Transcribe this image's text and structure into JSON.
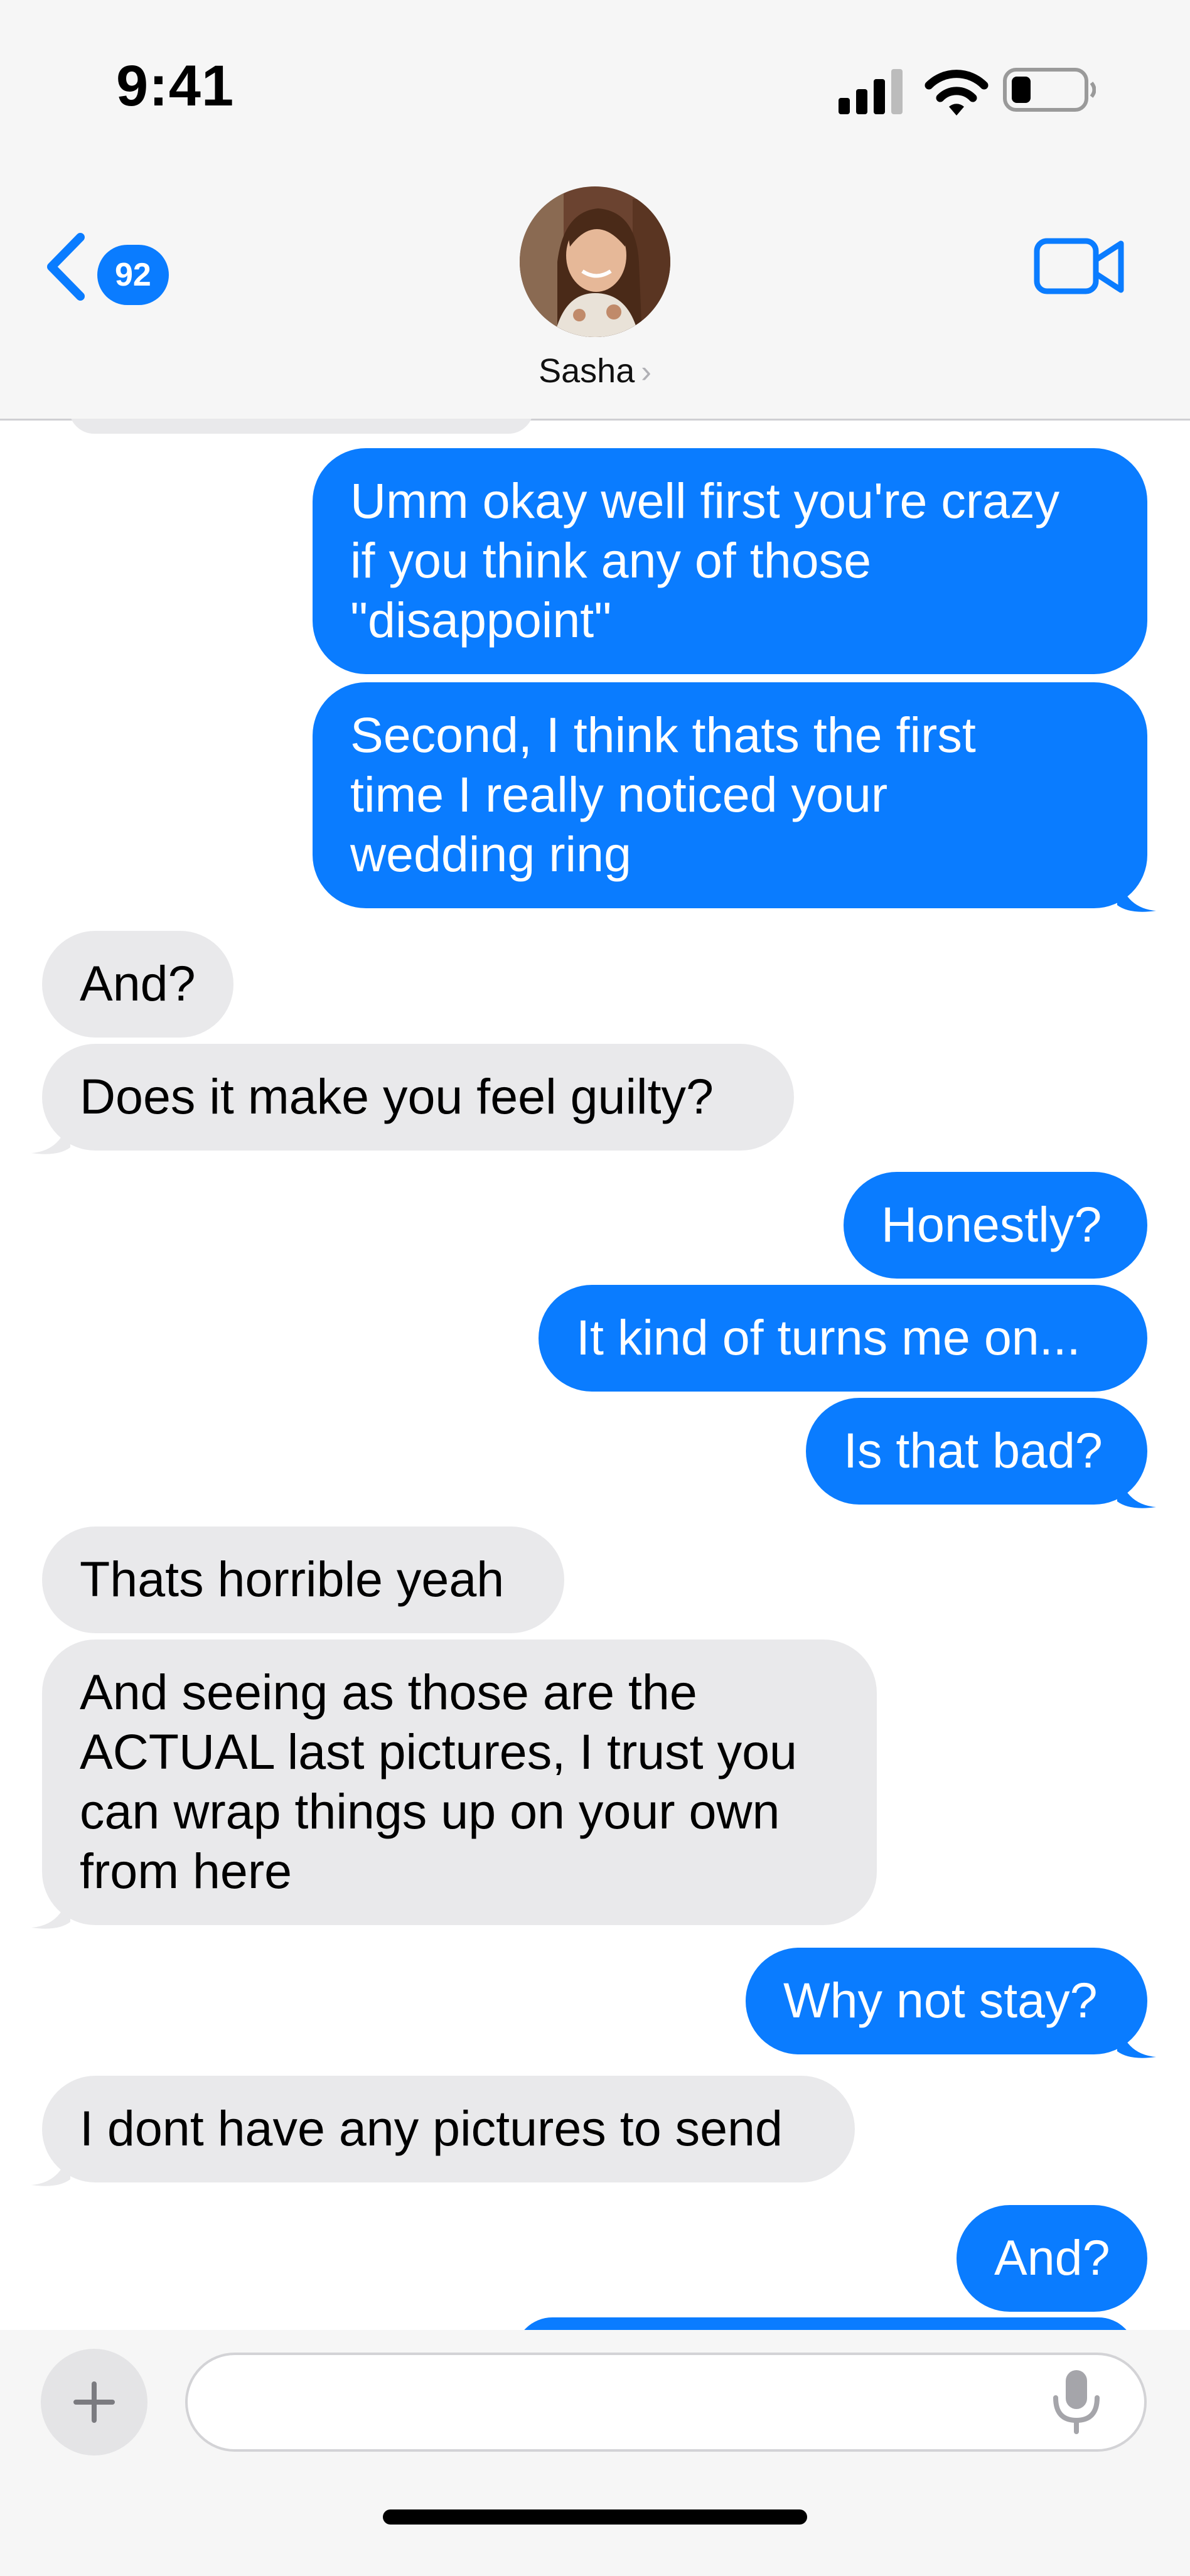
{
  "status_bar": {
    "time": "9:41",
    "icons": [
      "cellular-signal-icon",
      "wifi-icon",
      "battery-icon"
    ]
  },
  "header": {
    "back_badge": "92",
    "contact_name": "Sasha",
    "icons": [
      "chevron-left-icon",
      "video-camera-icon",
      "chevron-right-icon"
    ]
  },
  "messages": [
    {
      "from": "me",
      "text": "Umm okay well first you're crazy\nif you think any of those\n\"disappoint\""
    },
    {
      "from": "me",
      "text": "Second, I think thats the first\ntime I really noticed your\nwedding ring"
    },
    {
      "from": "them",
      "text": "And?"
    },
    {
      "from": "them",
      "text": "Does it make you feel guilty?"
    },
    {
      "from": "me",
      "text": "Honestly?"
    },
    {
      "from": "me",
      "text": "It kind of turns me on..."
    },
    {
      "from": "me",
      "text": "Is that bad?"
    },
    {
      "from": "them",
      "text": "Thats horrible yeah"
    },
    {
      "from": "them",
      "text": "And seeing as those are the\nACTUAL last pictures, I trust you\ncan wrap things up on your own\nfrom here"
    },
    {
      "from": "me",
      "text": "Why not stay?"
    },
    {
      "from": "them",
      "text": "I dont have any pictures to send"
    },
    {
      "from": "me",
      "text": "And?"
    }
  ],
  "compose": {
    "value": "",
    "placeholder": "",
    "icons": [
      "plus-icon",
      "microphone-icon"
    ]
  },
  "colors": {
    "sent_bubble": "#0a7cff",
    "received_bubble": "#e9e9eb",
    "bar_background": "#f6f6f6"
  }
}
